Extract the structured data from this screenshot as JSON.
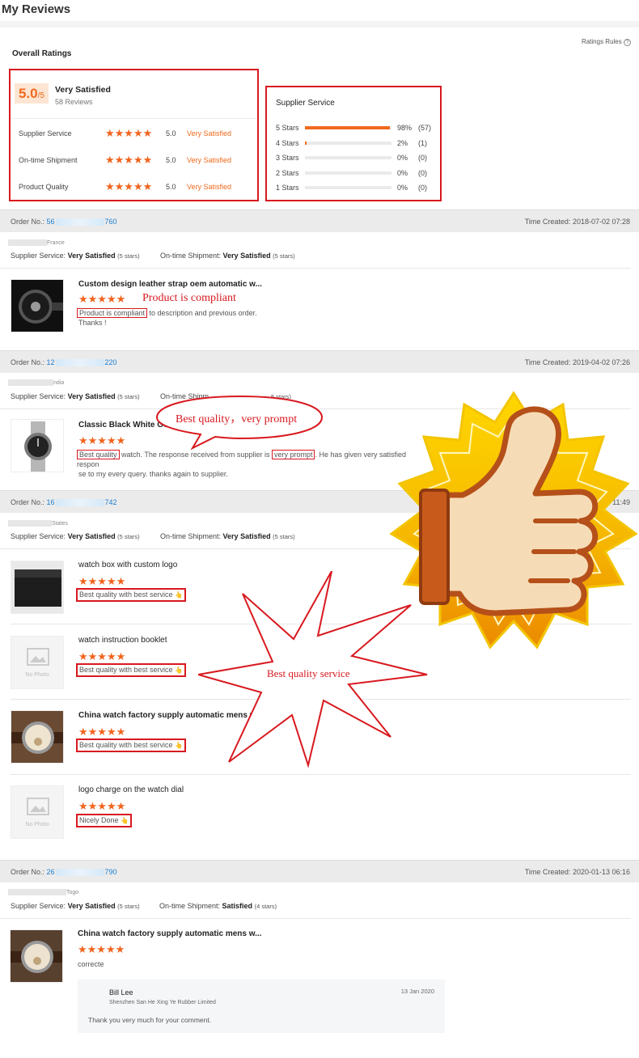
{
  "page_title": "My Reviews",
  "ratings_rules": "Ratings Rules",
  "overall": {
    "heading": "Overall Ratings",
    "score": "5.0",
    "score_suffix": "/5",
    "label": "Very Satisfied",
    "reviews": "58 Reviews",
    "rows": [
      {
        "name": "Supplier Service",
        "value": "5.0",
        "label": "Very Satisfied"
      },
      {
        "name": "On-time Shipment",
        "value": "5.0",
        "label": "Very Satisfied"
      },
      {
        "name": "Product Quality",
        "value": "5.0",
        "label": "Very Satisfied"
      }
    ]
  },
  "supplier_service": {
    "heading": "Supplier Service",
    "rows": [
      {
        "label": "5 Stars",
        "percent": "98%",
        "count": "(57)",
        "fraction": 0.98
      },
      {
        "label": "4 Stars",
        "percent": "2%",
        "count": "(1)",
        "fraction": 0.02
      },
      {
        "label": "3 Stars",
        "percent": "0%",
        "count": "(0)",
        "fraction": 0
      },
      {
        "label": "2 Stars",
        "percent": "0%",
        "count": "(0)",
        "fraction": 0
      },
      {
        "label": "1 Stars",
        "percent": "0%",
        "count": "(0)",
        "fraction": 0
      }
    ]
  },
  "labels": {
    "order_no": "Order No.:",
    "time_created": "Time Created:",
    "supplier_service": "Supplier Service:",
    "ontime_shipment": "On-time Shipment:",
    "no_photo": "No Photo"
  },
  "stars_glyph": "★★★★★",
  "orders": [
    {
      "order_prefix": "56",
      "order_suffix": "760",
      "time": "2018-07-02 07:28",
      "country": "France",
      "supplier_rating": "Very Satisfied",
      "supplier_stars": "(5 stars)",
      "shipment_rating": "Very Satisfied",
      "shipment_stars": "(5 stars)",
      "items": [
        {
          "title": "Custom design leather strap oem automatic w...",
          "highlight": "Product is compliant",
          "review_rest": " to description and previous order.",
          "review_line2": "Thanks !"
        }
      ]
    },
    {
      "order_prefix": "12",
      "order_suffix": "220",
      "time": "2019-04-02 07:26",
      "country": "ndia",
      "supplier_rating": "Very Satisfied",
      "supplier_stars": "(5 stars)",
      "shipment_label_partial": "On-time Shipm",
      "shipment_stars_partial": "5 stars)",
      "items": [
        {
          "title": "Classic Black White Go",
          "highlight1": "Best quality",
          "review_mid": " watch. The response received from supplier is ",
          "highlight2": "very prompt",
          "review_rest": ". He has given very satisfied respon",
          "review_line2": "se to my every query. thanks again to supplier."
        }
      ]
    },
    {
      "order_prefix": "16",
      "order_suffix": "742",
      "time_partial": "11:49",
      "country": "States",
      "supplier_rating": "Very Satisfied",
      "supplier_stars": "(5 stars)",
      "shipment_rating": "Very Satisfied",
      "shipment_stars": "(5 stars)",
      "items": [
        {
          "title": "watch box with custom logo",
          "tag": "Best quality with best service"
        },
        {
          "title": "watch instruction booklet",
          "tag": "Best quality with best service"
        },
        {
          "title": "China watch factory supply automatic mens w...",
          "tag": "Best quality with best service"
        },
        {
          "title": "logo charge on the watch dial",
          "tag": "Nicely Done"
        }
      ]
    },
    {
      "order_prefix": "26",
      "order_suffix": "790",
      "time": "2020-01-13 06:16",
      "country": "Togo",
      "supplier_rating": "Very Satisfied",
      "supplier_stars": "(5 stars)",
      "shipment_rating": "Satisfied",
      "shipment_stars": "(4 stars)",
      "items": [
        {
          "title": "China watch factory supply automatic mens w...",
          "review": "correcte"
        }
      ],
      "reply": {
        "name": "Bill Lee",
        "company": "Shenzhen San He Xing Ye Rubber Limited",
        "date": "13 Jan 2020",
        "text": "Thank you very much for your comment."
      }
    }
  ],
  "callouts": {
    "compliant": "Product is compliant",
    "prompt": "Best quality，very prompt",
    "service": "Best quality service"
  },
  "colors": {
    "accent": "#f06a1e",
    "highlight_red": "#d8191f",
    "link_blue": "#1a7fd4"
  }
}
